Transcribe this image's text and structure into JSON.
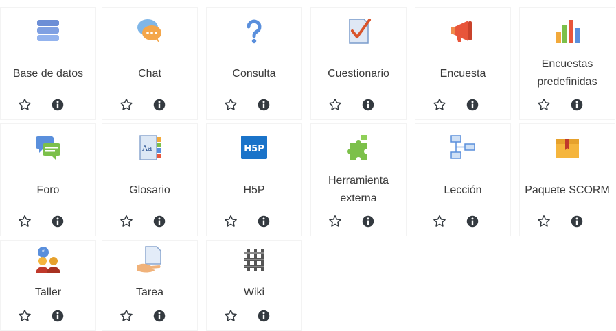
{
  "activities": [
    {
      "name": "Base de datos",
      "icon": "database-icon"
    },
    {
      "name": "Chat",
      "icon": "chat-bubbles-icon"
    },
    {
      "name": "Consulta",
      "icon": "question-mark-icon"
    },
    {
      "name": "Cuestionario",
      "icon": "quiz-checkmark-icon"
    },
    {
      "name": "Encuesta",
      "icon": "megaphone-icon"
    },
    {
      "name": "Encuestas predefinidas",
      "icon": "bar-chart-icon"
    },
    {
      "name": "Foro",
      "icon": "forum-bubbles-icon"
    },
    {
      "name": "Glosario",
      "icon": "glossary-book-icon"
    },
    {
      "name": "H5P",
      "icon": "h5p-logo-icon"
    },
    {
      "name": "Herramienta externa",
      "icon": "puzzle-piece-icon"
    },
    {
      "name": "Lección",
      "icon": "lesson-flowchart-icon"
    },
    {
      "name": "Paquete SCORM",
      "icon": "scorm-package-box-icon"
    },
    {
      "name": "Taller",
      "icon": "workshop-people-icon"
    },
    {
      "name": "Tarea",
      "icon": "assignment-hand-icon"
    },
    {
      "name": "Wiki",
      "icon": "wiki-knot-icon"
    }
  ],
  "actions": {
    "star_icon": "star-outline-icon",
    "info_icon": "info-circle-icon"
  },
  "colors": {
    "text": "#3b3b3b",
    "icon_dark": "#343a40",
    "tile_border": "#f3f3f3"
  }
}
